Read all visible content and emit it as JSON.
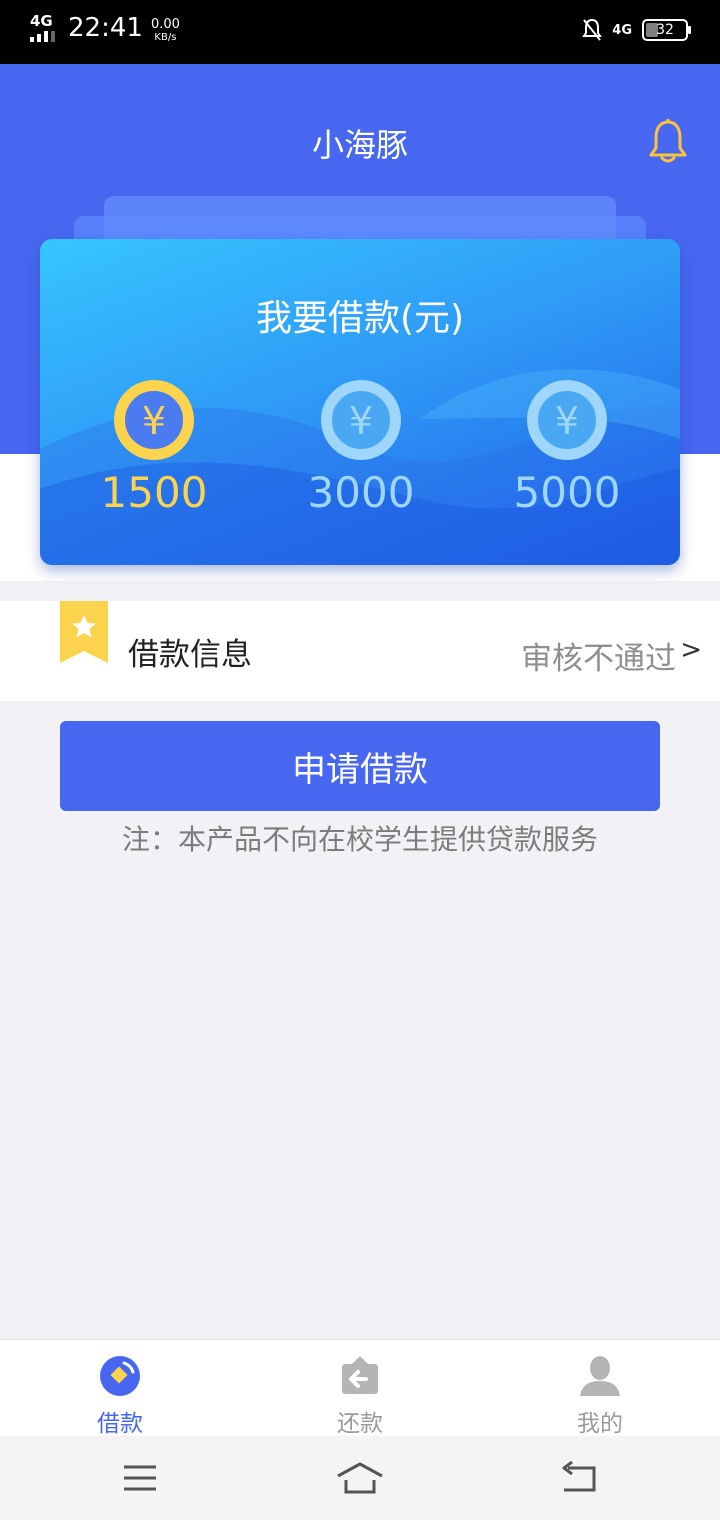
{
  "status_bar": {
    "network": "4G",
    "time": "22:41",
    "speed_value": "0.00",
    "speed_unit": "KB/s",
    "network_right": "4G",
    "battery": "32"
  },
  "header": {
    "title": "小海豚",
    "bell_icon": "bell-icon"
  },
  "loan_card": {
    "title": "我要借款(元)",
    "amounts": [
      {
        "label": "1500",
        "selected": true
      },
      {
        "label": "3000",
        "selected": false
      },
      {
        "label": "5000",
        "selected": false
      }
    ],
    "coin_symbol": "¥"
  },
  "info_row": {
    "label": "借款信息",
    "status": "审核不通过",
    "arrow": ">"
  },
  "apply_button": {
    "label": "申请借款"
  },
  "notice": "注：本产品不向在校学生提供贷款服务",
  "tab_bar": {
    "tabs": [
      {
        "label": "借款",
        "icon": "loan-icon",
        "active": true
      },
      {
        "label": "还款",
        "icon": "repay-icon",
        "active": false
      },
      {
        "label": "我的",
        "icon": "profile-icon",
        "active": false
      }
    ]
  },
  "colors": {
    "primary": "#4867f0",
    "gold": "#fcd34d",
    "inactive_amount": "#9fd6fb",
    "muted_text": "#8f8f8f",
    "page_bg": "#f2f1f6"
  }
}
